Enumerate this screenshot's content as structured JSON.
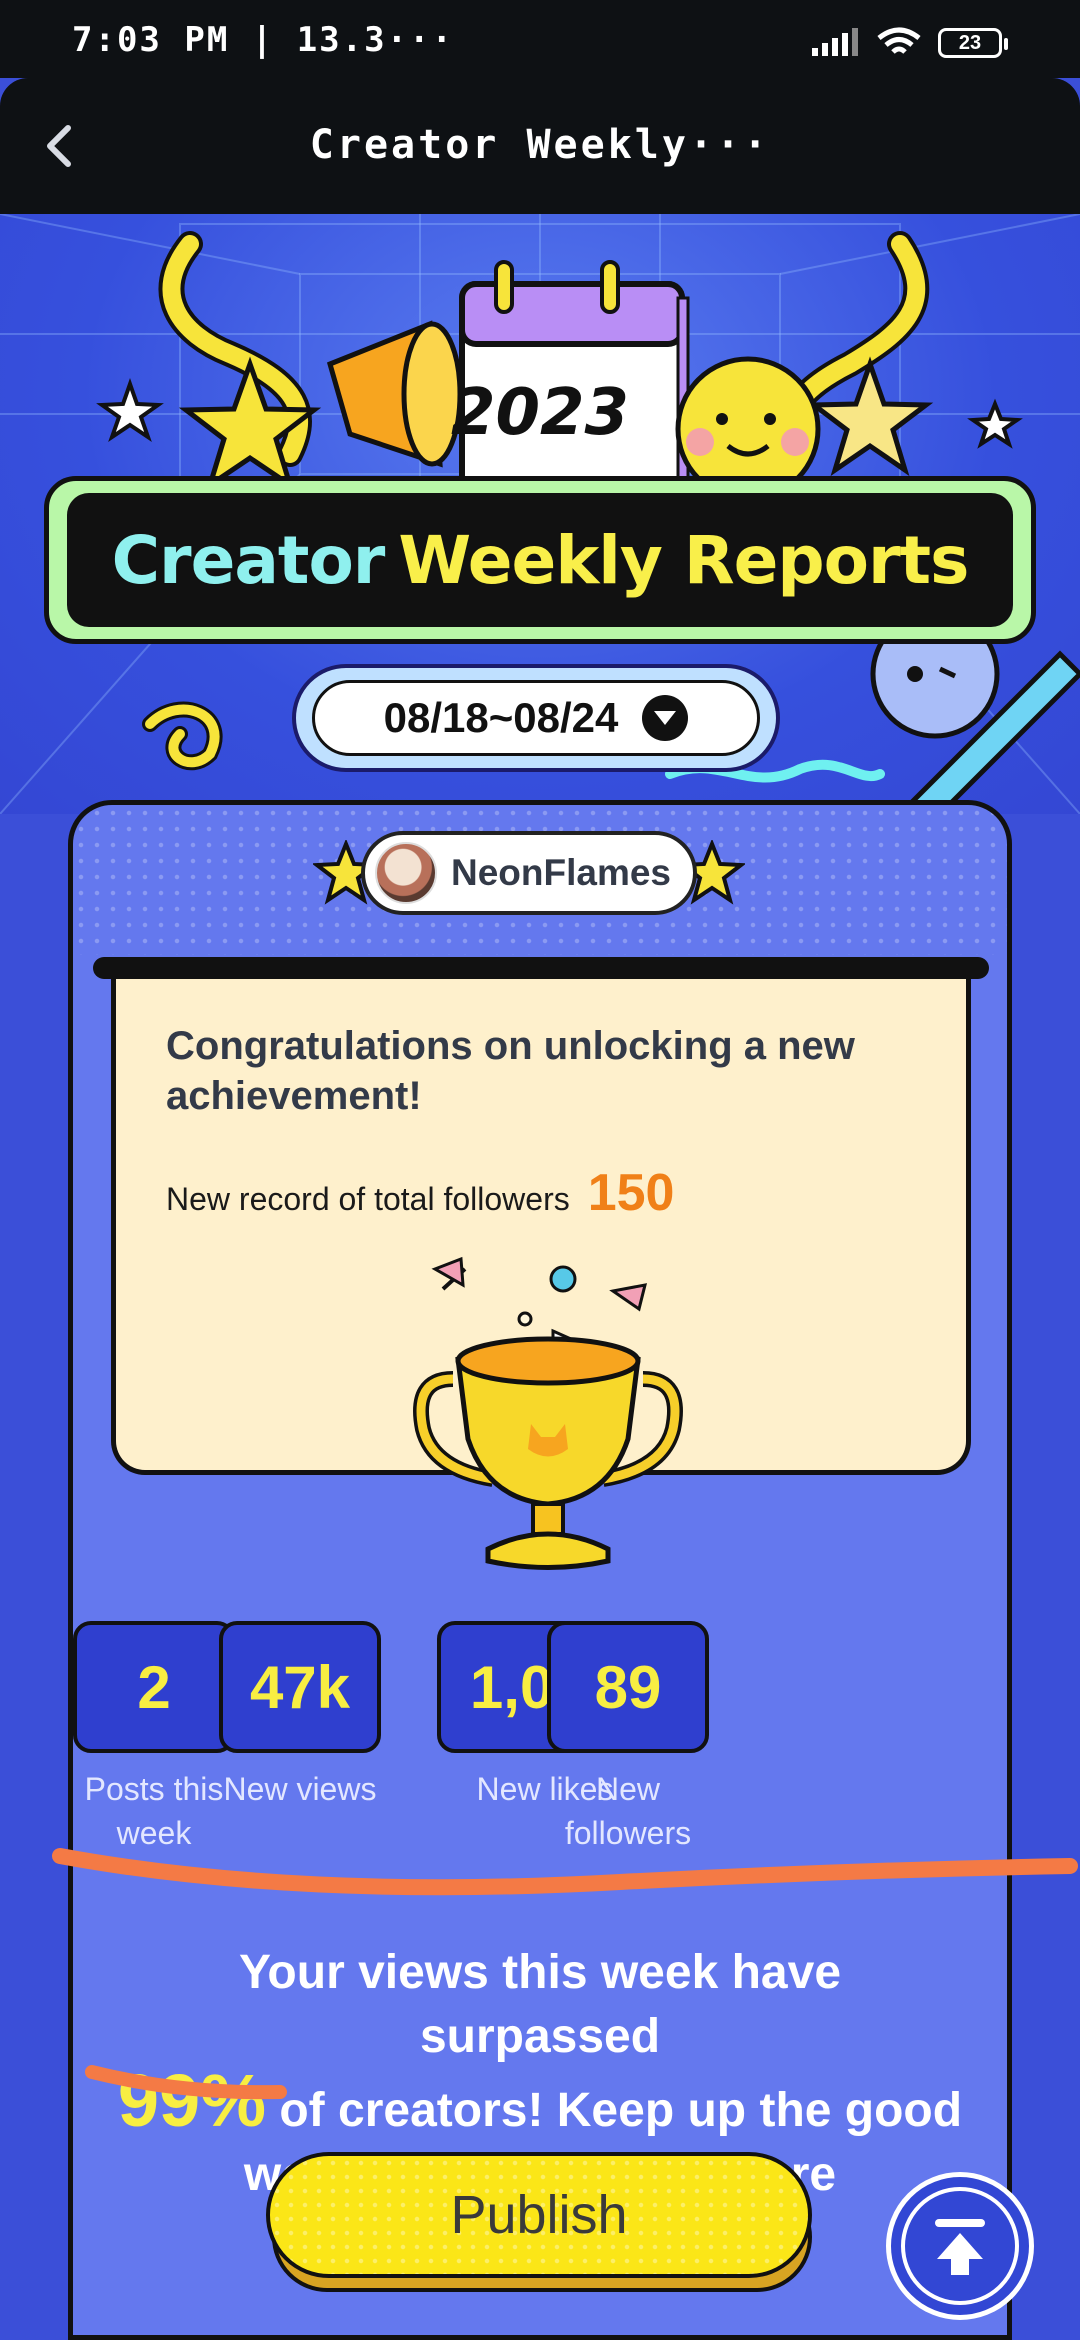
{
  "status_bar": {
    "time": "7:03 PM | 13.3···",
    "battery": "23"
  },
  "header": {
    "title": "Creator Weekly···"
  },
  "banner": {
    "year": "2023",
    "title_part1": "Creator",
    "title_part2": "Weekly Reports",
    "date_range": "08/18~08/24"
  },
  "card": {
    "username": "NeonFlames",
    "congrats": "Congratulations on unlocking a new achievement!",
    "record_label": "New record of total followers",
    "record_value": "150",
    "stats": [
      {
        "value": "2",
        "label": "Posts this week"
      },
      {
        "value": "47k",
        "label": "New views"
      },
      {
        "value": "1,082",
        "label": "New likes"
      },
      {
        "value": "89",
        "label": "New followers"
      }
    ],
    "surpass_pre": "Your views this week have surpassed",
    "surpass_pct": "99%",
    "surpass_post": "of creators! Keep up the good work to unlock even more"
  },
  "footer": {
    "publish_label": "Publish"
  },
  "colors": {
    "accent": "#f8ee42",
    "card": "#6478ee",
    "background": "#3b4fd8",
    "annotation": "#f47a45"
  }
}
